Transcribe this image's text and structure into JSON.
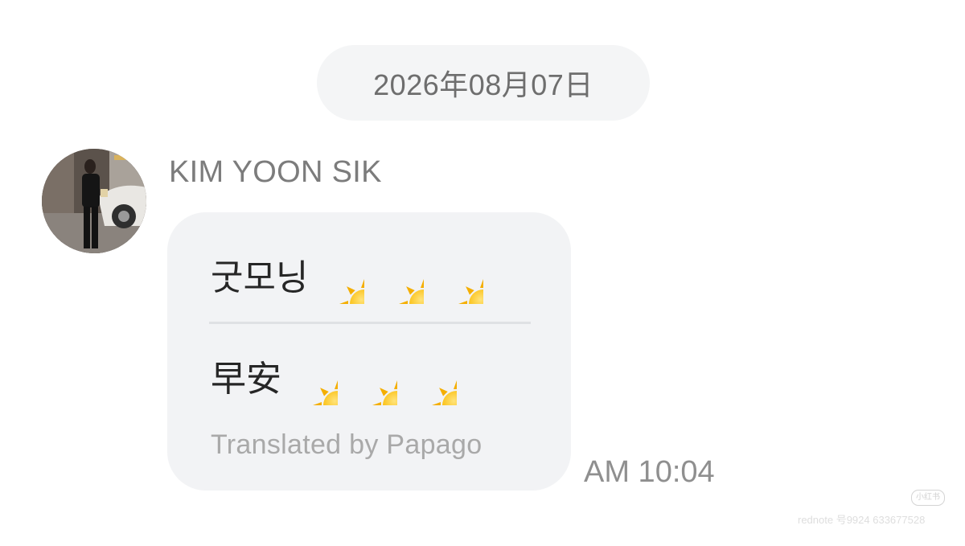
{
  "date_separator": "2026年08月07日",
  "message": {
    "sender": "KIM YOON SIK",
    "original_text": "굿모닝",
    "translated_text": "早安",
    "emoji_icon": "sun-emoji",
    "emoji_count": 3,
    "translation_credit": "Translated by Papago",
    "time": "AM 10:04"
  },
  "watermark": {
    "badge": "小红书",
    "text": "rednote 号9924 633677528"
  },
  "colors": {
    "bubble": "#f2f3f5",
    "date_pill": "#f4f5f6",
    "sun": "#f6b700"
  }
}
